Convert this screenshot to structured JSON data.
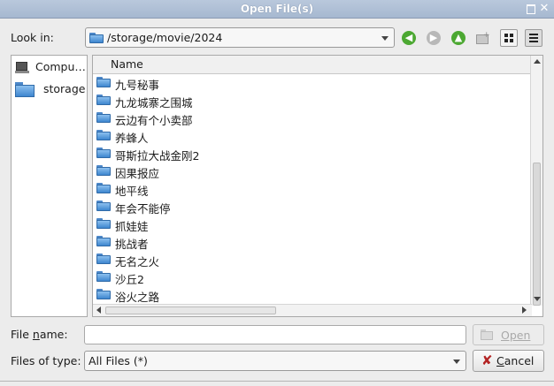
{
  "window": {
    "title": "Open File(s)"
  },
  "look_in": {
    "label": "Look in:",
    "path": "/storage/movie/2024",
    "icons": [
      "back-arrow-icon",
      "forward-arrow-icon",
      "parent-folder-icon",
      "new-folder-icon",
      "list-view-icon",
      "detail-view-icon"
    ]
  },
  "sidebar": {
    "items": [
      {
        "label": "Compu…",
        "icon": "computer-icon"
      },
      {
        "label": "storage",
        "icon": "folder-icon"
      }
    ]
  },
  "file_list": {
    "column_header": "Name",
    "rows": [
      "九号秘事",
      "九龙城寨之围城",
      "云边有个小卖部",
      "养蜂人",
      "哥斯拉大战金刚2",
      "因果报应",
      "地平线",
      "年会不能停",
      "抓娃娃",
      "挑战者",
      "无名之火",
      "沙丘2",
      "浴火之路"
    ]
  },
  "file_name": {
    "label_before": "File ",
    "label_underlined": "n",
    "label_after": "ame:",
    "value": "",
    "open_label": "Open"
  },
  "file_type": {
    "label": "Files of type:",
    "value": "All Files (*)",
    "cancel_label": "Cancel"
  },
  "colors": {
    "titlebar": "#b9c8dc",
    "folder": "#3e86cf",
    "nav_green": "#4ca832"
  }
}
